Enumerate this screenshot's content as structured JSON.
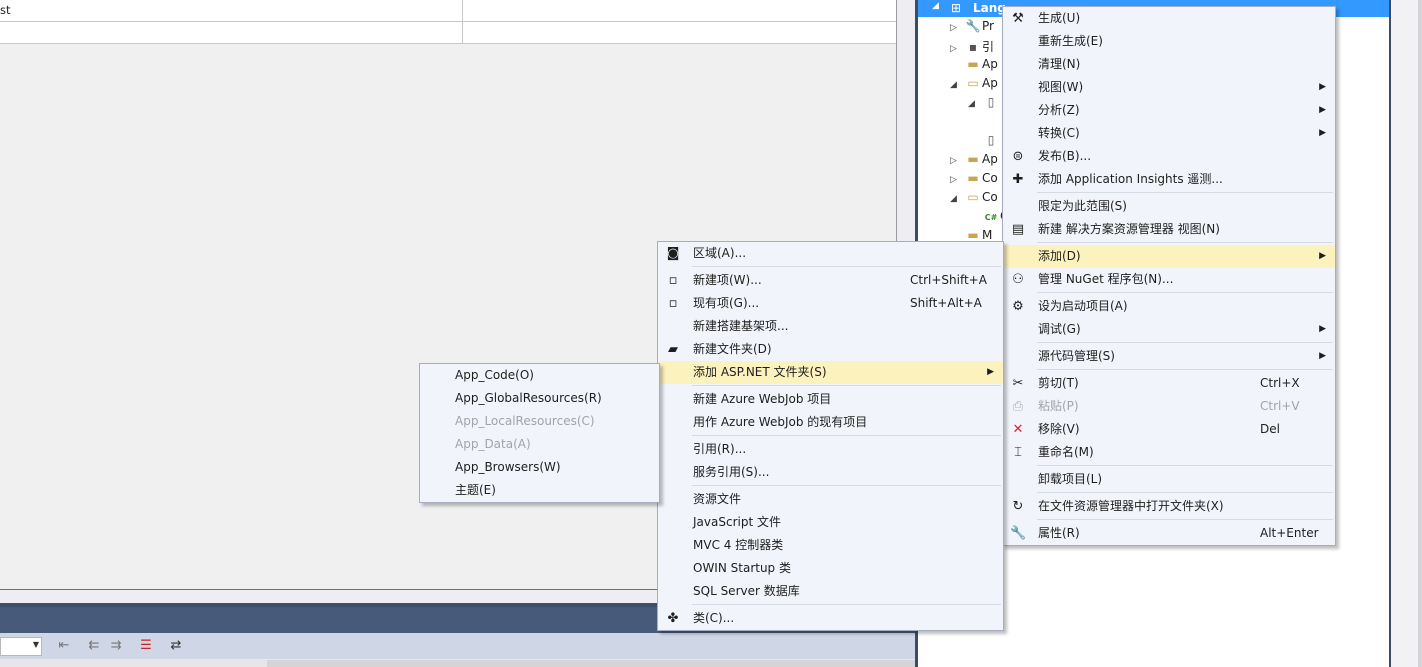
{
  "document_grid": {
    "row1_text": "st",
    "row2_text": ""
  },
  "solution_explorer": {
    "selected_item": "Lang",
    "items": [
      {
        "expander": "▷",
        "icon": "wrench-icon",
        "label": "Pr"
      },
      {
        "expander": "▷",
        "icon": "references-icon",
        "label": "引"
      },
      {
        "expander": "",
        "icon": "folder-icon",
        "label": "Ap"
      },
      {
        "expander": "◢",
        "icon": "folder-open-icon",
        "label": "Ap"
      },
      {
        "expander": "◢",
        "icon": "file-icon",
        "label": ""
      },
      {
        "expander": "",
        "icon": "file-icon",
        "label": ""
      },
      {
        "expander": "▷",
        "icon": "folder-icon",
        "label": "Ap"
      },
      {
        "expander": "▷",
        "icon": "folder-icon",
        "label": "Co"
      },
      {
        "expander": "◢",
        "icon": "folder-open-icon",
        "label": "Co"
      },
      {
        "expander": "",
        "icon": "csharp-icon",
        "label": "C#"
      },
      {
        "expander": "",
        "icon": "folder-icon",
        "label": "M"
      }
    ]
  },
  "project_menu": {
    "items": [
      {
        "label": "生成(U)",
        "icon": "build-icon"
      },
      {
        "label": "重新生成(E)"
      },
      {
        "label": "清理(N)"
      },
      {
        "label": "视图(W)",
        "submenu": true
      },
      {
        "label": "分析(Z)",
        "submenu": true
      },
      {
        "label": "转换(C)",
        "submenu": true
      },
      {
        "label": "发布(B)...",
        "icon": "publish-icon"
      },
      {
        "label": "添加 Application Insights 遥测...",
        "icon": "insights-icon"
      },
      {
        "sep": true
      },
      {
        "label": "限定为此范围(S)"
      },
      {
        "label": "新建 解决方案资源管理器 视图(N)",
        "icon": "new-view-icon"
      },
      {
        "sep": true
      },
      {
        "label": "添加(D)",
        "submenu": true,
        "highlight": true
      },
      {
        "label": "管理 NuGet 程序包(N)...",
        "icon": "nuget-icon"
      },
      {
        "sep": true
      },
      {
        "label": "设为启动项目(A)",
        "icon": "gear-icon"
      },
      {
        "label": "调试(G)",
        "submenu": true
      },
      {
        "sep": true
      },
      {
        "label": "源代码管理(S)",
        "submenu": true
      },
      {
        "sep": true
      },
      {
        "label": "剪切(T)",
        "shortcut": "Ctrl+X",
        "icon": "cut-icon"
      },
      {
        "label": "粘贴(P)",
        "shortcut": "Ctrl+V",
        "icon": "paste-icon",
        "disabled": true
      },
      {
        "label": "移除(V)",
        "shortcut": "Del",
        "icon": "remove-icon"
      },
      {
        "label": "重命名(M)",
        "icon": "rename-icon"
      },
      {
        "sep": true
      },
      {
        "label": "卸载项目(L)"
      },
      {
        "sep": true
      },
      {
        "label": "在文件资源管理器中打开文件夹(X)",
        "icon": "open-folder-arrow-icon"
      },
      {
        "sep": true
      },
      {
        "label": "属性(R)",
        "shortcut": "Alt+Enter",
        "icon": "wrench-icon"
      }
    ]
  },
  "add_menu": {
    "items": [
      {
        "label": "区域(A)...",
        "icon": "area-icon"
      },
      {
        "sep": true
      },
      {
        "label": "新建项(W)...",
        "shortcut": "Ctrl+Shift+A",
        "icon": "new-item-icon"
      },
      {
        "label": "现有项(G)...",
        "shortcut": "Shift+Alt+A",
        "icon": "existing-item-icon"
      },
      {
        "label": "新建搭建基架项..."
      },
      {
        "label": "新建文件夹(D)",
        "icon": "new-folder-icon"
      },
      {
        "label": "添加 ASP.NET 文件夹(S)",
        "submenu": true,
        "highlight": true
      },
      {
        "sep": true
      },
      {
        "label": "新建 Azure WebJob 项目"
      },
      {
        "label": "用作 Azure WebJob 的现有项目"
      },
      {
        "sep": true
      },
      {
        "label": "引用(R)..."
      },
      {
        "label": "服务引用(S)..."
      },
      {
        "sep": true
      },
      {
        "label": "资源文件"
      },
      {
        "label": "JavaScript 文件"
      },
      {
        "label": "MVC 4 控制器类"
      },
      {
        "label": "OWIN Startup 类"
      },
      {
        "label": "SQL Server 数据库"
      },
      {
        "sep": true
      },
      {
        "label": "类(C)...",
        "icon": "class-icon"
      }
    ]
  },
  "aspnet_menu": {
    "items": [
      {
        "label": "App_Code(O)"
      },
      {
        "label": "App_GlobalResources(R)"
      },
      {
        "label": "App_LocalResources(C)",
        "disabled": true
      },
      {
        "label": "App_Data(A)",
        "disabled": true
      },
      {
        "label": "App_Browsers(W)"
      },
      {
        "label": "主题(E)"
      }
    ]
  },
  "icons": {
    "build-icon": "⚒",
    "publish-icon": "⊜",
    "insights-icon": "✚",
    "new-view-icon": "▤",
    "nuget-icon": "⚇",
    "gear-icon": "⚙",
    "cut-icon": "✂",
    "paste-icon": "⎙",
    "remove-icon": "✕",
    "rename-icon": "⌶",
    "open-folder-arrow-icon": "↻",
    "wrench-icon": "🔧",
    "area-icon": "◙",
    "new-item-icon": "▫",
    "existing-item-icon": "▫",
    "new-folder-icon": "▰",
    "class-icon": "✤",
    "folder-icon": "▬",
    "folder-open-icon": "▭",
    "file-icon": "▯",
    "csharp-icon": "C#",
    "references-icon": "▪",
    "solution-icon": "⊞"
  },
  "colors": {
    "selection": "#3399ff",
    "menu_highlight": "#fcf2be",
    "remove_icon": "#d8262e",
    "chrome_blue": "#475a7a"
  }
}
